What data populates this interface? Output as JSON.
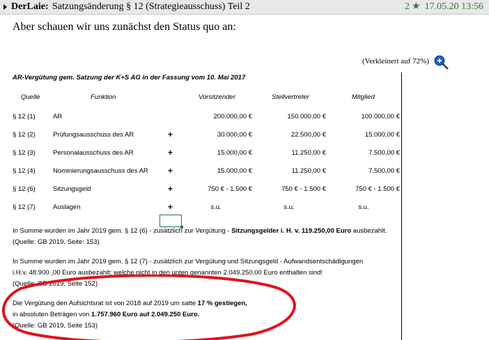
{
  "header": {
    "author": "DerLaie:",
    "title": "Satzungsänderung § 12 (Strategieausschuss) Teil 2",
    "rating": "2",
    "date": "17.05.20 13:56"
  },
  "intro": "Aber schauen wir uns zunächst den Status quo an:",
  "document": {
    "zoom_note": "(Verkleinert auf 72%)",
    "heading": "AR-Vergütung gem. Satzung der K+S AG in der Fassung vom 10. Mai 2017",
    "columns": [
      "Quelle",
      "Funktion",
      "Vorsitzender",
      "Stellvertreter",
      "Mitglied"
    ],
    "rows": [
      {
        "quelle": "§ 12 (1)",
        "funktion": "AR",
        "plus": "",
        "vorsitzender": "200.000,00 €",
        "stellvertreter": "150.000,00 €",
        "mitglied": "100.000,00 €"
      },
      {
        "quelle": "§ 12 (2)",
        "funktion": "Prüfungsausschuss des AR",
        "plus": "+",
        "vorsitzender": "30.000,00 €",
        "stellvertreter": "22.500,00 €",
        "mitglied": "15.000,00 €"
      },
      {
        "quelle": "§ 12 (3)",
        "funktion": "Personalausschuss des AR",
        "plus": "+",
        "vorsitzender": "15.000,00 €",
        "stellvertreter": "11.250,00 €",
        "mitglied": "7.500,00 €"
      },
      {
        "quelle": "§ 12 (4)",
        "funktion": "Nominierungsausschuss des AR",
        "plus": "+",
        "vorsitzender": "15.000,00 €",
        "stellvertreter": "11.250,00 €",
        "mitglied": "7.500,00 €"
      },
      {
        "quelle": "§ 12 (6)",
        "funktion": "Sitzungsgeld",
        "plus": "+",
        "vorsitzender": "750 € - 1.500 €",
        "stellvertreter": "750 € - 1.500 €",
        "mitglied": "750 € - 1.500 €"
      },
      {
        "quelle": "§ 12 (7)",
        "funktion": "Auslagen",
        "plus": "+",
        "vorsitzender": "s.u.",
        "stellvertreter": "s.u.",
        "mitglied": "s.u."
      }
    ],
    "para1": {
      "pre": "In Summe wurden im Jahr 2019 gem. § 12 (6) -  zusätzlich zur Vergütung - ",
      "bold": "Sitzungsgelder i. H. v. 119.250,00 Euro",
      "post": " ausbezahlt.",
      "source": "(Quelle: GB 2019, Seite: 153)"
    },
    "para2": {
      "line1": "In Summe wurden im Jahr 2019 gem. § 12 (7) -  zusätzlich zur Vergütung und Sitzungsgeld - Aufwandsentschädigungen",
      "line2": "i.H.v. 48.900 ,00 Euro ausbezahlt; welche nicht in den unten genannten 2.049.250,00 Euro enthalten sind!",
      "source": "(Quelle: GB 2019, Seite 152)"
    },
    "para3": {
      "l1_pre": "Die Vergütung den Aufsichtsrat ist von 2018 auf 2019 um satte ",
      "l1_bold": "17 % gestiegen,",
      "l2_pre": "in absoluten Beträgen von ",
      "l2_bold": "1.757.960 Euro auf 2.049.250 Euro.",
      "source": "(Quelle: GB 2019, Seite 153)"
    }
  },
  "icons": {
    "post_arrow": "triangle-right-icon",
    "rating": "star-icon",
    "zoom": "zoom-in-icon"
  },
  "colors": {
    "topbar": "#e8e8e8",
    "rating": "#2e7d32",
    "ellipse": "#e0141e",
    "zoom_icon": "#1f5fc4",
    "selection": "#1e7b45"
  }
}
